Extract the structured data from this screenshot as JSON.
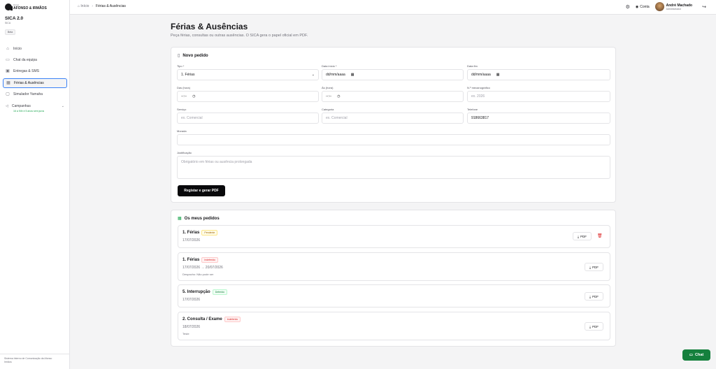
{
  "brand": {
    "small": "Grupo",
    "name": "AFONSO & IRMÃOS"
  },
  "app": {
    "title": "SICA 2.0",
    "subtitle": "SICA",
    "badge": "Beta"
  },
  "nav": [
    {
      "label": "Início",
      "icon": "home-icon",
      "active": false
    },
    {
      "label": "Chat da equipa",
      "icon": "chat-icon",
      "active": false
    },
    {
      "label": "Entregas & SMS",
      "icon": "truck-icon",
      "active": false
    },
    {
      "label": "Férias & Ausências",
      "icon": "calendar-icon",
      "active": true
    },
    {
      "label": "Simulador Yamaha",
      "icon": "monitor-icon",
      "active": false
    }
  ],
  "campaigns": {
    "label": "Campanhas",
    "sub": "16 a 94h e 5 anos sem juros"
  },
  "footer": {
    "line1": "Sistema Interno de Comunicação da Afonso",
    "line2": "Irmãos"
  },
  "topbar": {
    "home": "Início",
    "current": "Férias & Ausências",
    "account": "Conta",
    "user_name": "André Machado",
    "user_role": "Administrador"
  },
  "page": {
    "title": "Férias & Ausências",
    "subtitle": "Peça férias, consultas ou outras ausências. O SICA gera o papel oficial em PDF."
  },
  "form": {
    "heading": "Novo pedido",
    "tipo_label": "Tipo *",
    "tipo_value": "1. Férias",
    "inicio_label": "Data início *",
    "inicio_value": "dd/mm/aaaa",
    "fim_label": "Data fim",
    "fim_value": "dd/mm/aaaa",
    "das_label": "Das (hora)",
    "das_value": "--:--",
    "as_label": "Às (hora)",
    "as_value": "--:--",
    "meca_label": "N.º mecanográfico",
    "meca_placeholder": "ex. 2026",
    "servico_label": "Serviço",
    "servico_placeholder": "ex. Comercial",
    "categoria_label": "Categoria",
    "categoria_placeholder": "ex. Comercial",
    "telefone_label": "Telefone",
    "telefone_value": "918663817",
    "morada_label": "Morada",
    "morada_value": "",
    "just_label": "Justificação",
    "just_placeholder": "Obrigatório em férias ou ausência prolongada",
    "submit": "Registar e gerar PDF"
  },
  "requests": {
    "heading": "Os meus pedidos",
    "pdf_label": "PDF",
    "items": [
      {
        "title": "1. Férias",
        "status": "Pendente",
        "status_color": "#a16207",
        "date": "17/07/2026",
        "note": ""
      },
      {
        "title": "1. Férias",
        "status": "Indeferido",
        "status_color": "#dc2626",
        "date": "17/07/2026 → 20/07/2026",
        "note": "Despacho: Não pode ser"
      },
      {
        "title": "5. Interrupção",
        "status": "Deferido",
        "status_color": "#15803d",
        "date": "17/07/2026",
        "note": ""
      },
      {
        "title": "2. Consulta / Exame",
        "status": "Indeferido",
        "status_color": "#dc2626",
        "date": "18/07/2026",
        "note": "Teste"
      }
    ]
  },
  "chat_button": "Chat"
}
